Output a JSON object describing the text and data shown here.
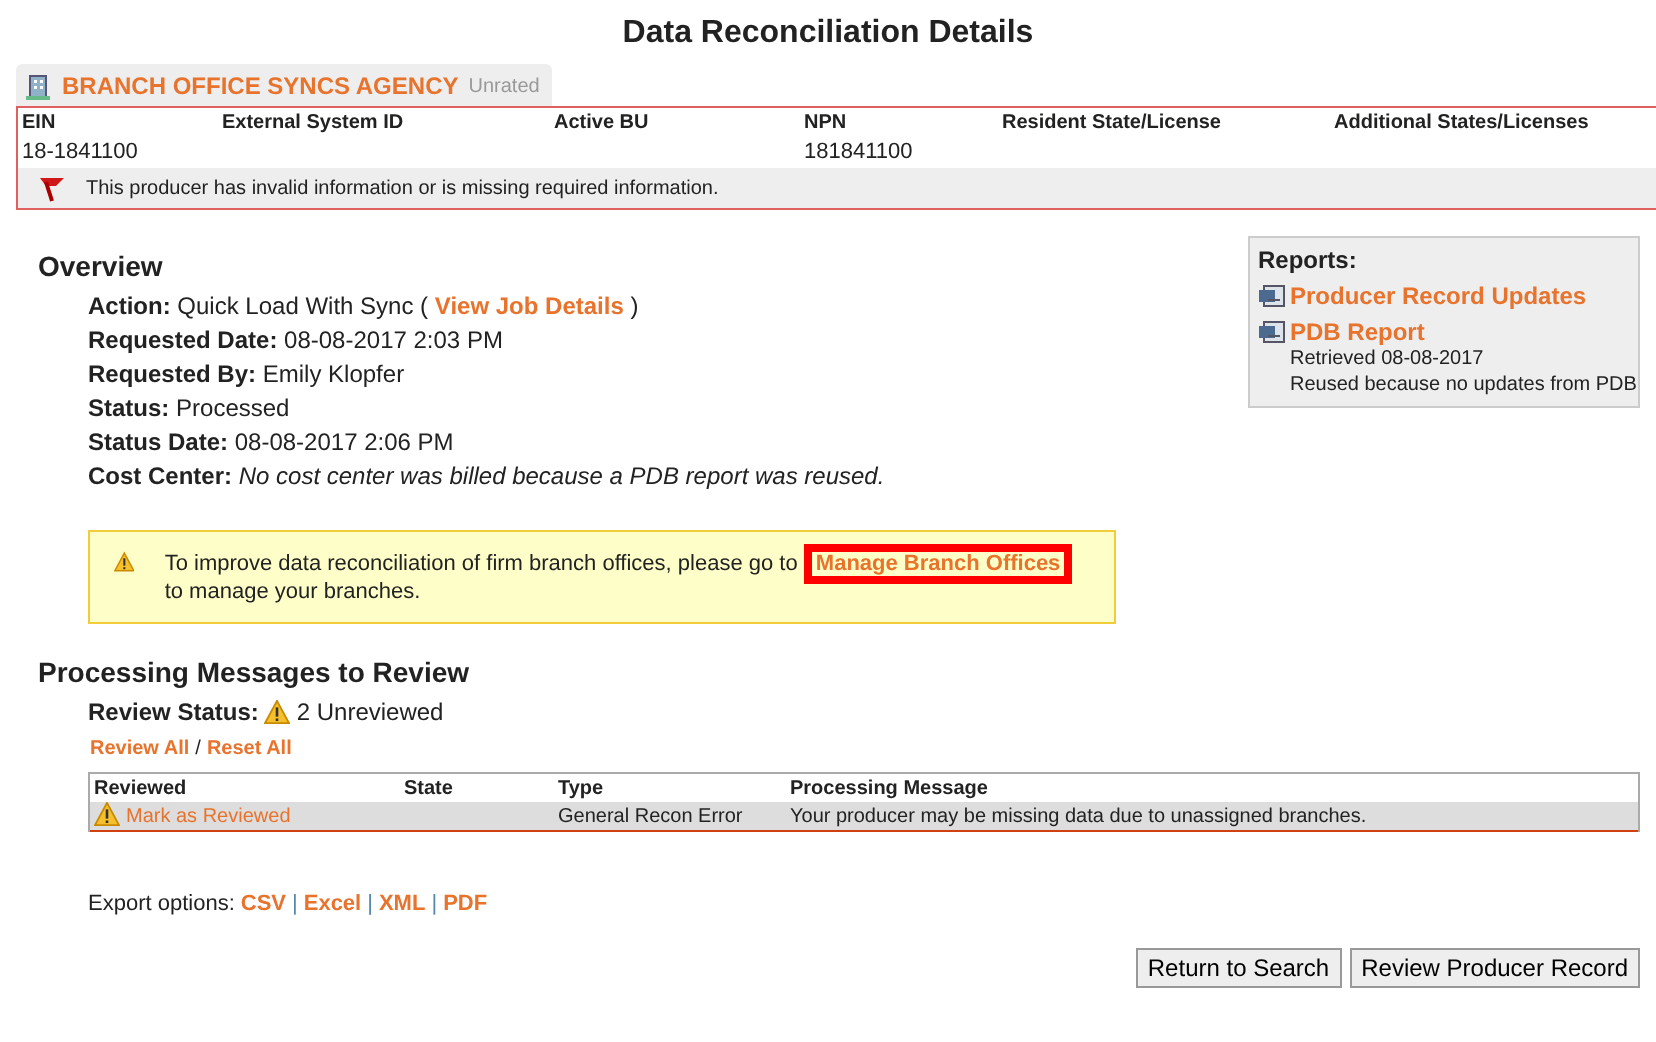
{
  "title": "Data Reconciliation Details",
  "agency": {
    "name": "BRANCH OFFICE SYNCS AGENCY",
    "rating": "Unrated"
  },
  "producer_table": {
    "columns": [
      {
        "header": "EIN",
        "value": "18-1841100"
      },
      {
        "header": "External System ID"
      },
      {
        "header": "Active BU"
      },
      {
        "header": "NPN",
        "value": "181841100"
      },
      {
        "header": "Resident State/License"
      },
      {
        "header": "Additional States/Licenses"
      }
    ],
    "warning": "This producer has invalid information or is missing required information."
  },
  "overview": {
    "heading": "Overview",
    "rows": [
      {
        "label": "Action:",
        "value": "Quick Load With Sync (",
        "link": "View Job Details",
        "suffix": ")",
        "italic": false
      },
      {
        "label": "Requested Date:",
        "value": "08-08-2017 2:03 PM",
        "italic": false
      },
      {
        "label": "Requested By:",
        "value": "Emily Klopfer",
        "italic": false
      },
      {
        "label": "Status:",
        "value": "Processed",
        "italic": false
      },
      {
        "label": "Status Date:",
        "value": "08-08-2017 2:06 PM",
        "italic": false
      },
      {
        "label": "Cost Center:",
        "value": "No cost center was billed because a PDB report was reused.",
        "italic": true
      }
    ]
  },
  "notice": {
    "text_before": "To improve data reconciliation of firm branch offices, please go to",
    "link": "Manage Branch Offices",
    "highlighted": true,
    "text_after": "to manage your branches."
  },
  "reports": {
    "heading": "Reports:",
    "items": [
      {
        "label": "Producer Record Updates"
      },
      {
        "label": "PDB Report",
        "notes": [
          "Retrieved 08-08-2017",
          "Reused because no updates from PDB"
        ]
      }
    ]
  },
  "messages": {
    "heading": "Processing Messages to Review",
    "status_label": "Review Status:",
    "status_value": "2 Unreviewed",
    "actions": [
      "Review All",
      "Reset All"
    ],
    "action_separator": "/",
    "columns": [
      "Reviewed",
      "State",
      "Type",
      "Processing Message"
    ],
    "rows": [
      {
        "reviewed": false,
        "action": "Mark as Reviewed",
        "type": "General Recon Error",
        "message": "Your producer may be missing data due to unassigned branches."
      }
    ]
  },
  "export": {
    "label": "Export options:",
    "separator": "|",
    "options": [
      "CSV",
      "Excel",
      "XML",
      "PDF"
    ]
  },
  "buttons": [
    "Return to Search",
    "Review Producer Record"
  ]
}
